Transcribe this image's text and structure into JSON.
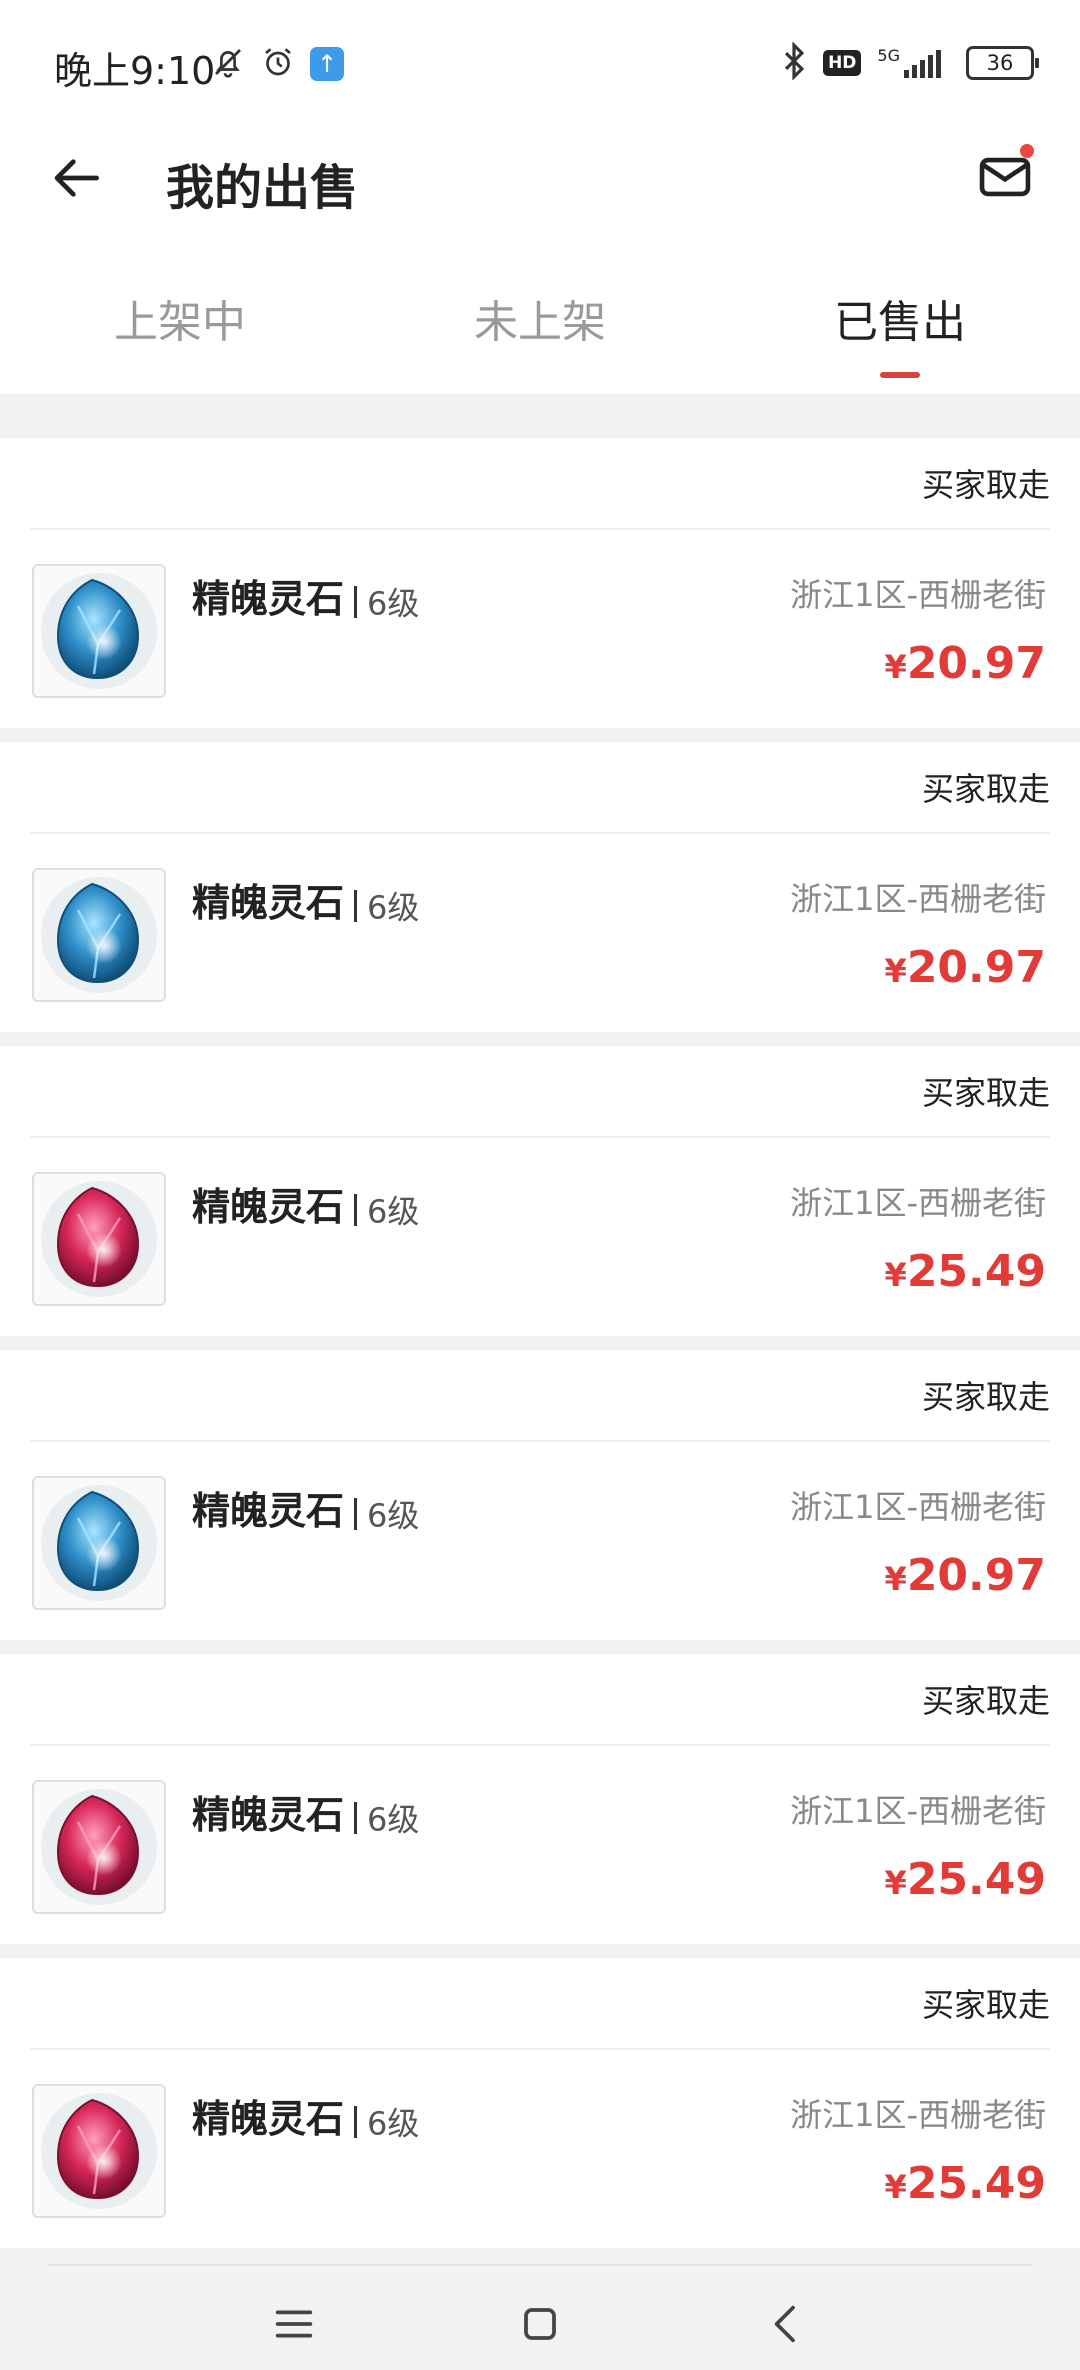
{
  "status_bar": {
    "time": "晚上9:10",
    "hd": "HD",
    "network": "5G",
    "battery": "36"
  },
  "header": {
    "title": "我的出售"
  },
  "tabs": [
    {
      "label": "上架中",
      "active": false
    },
    {
      "label": "未上架",
      "active": false
    },
    {
      "label": "已售出",
      "active": true
    }
  ],
  "orders": [
    {
      "status": "买家取走",
      "name": "精魄灵石",
      "level": "6级",
      "server": "浙江1区-西栅老街",
      "currency": "¥",
      "price": "20.97",
      "gem": "blue"
    },
    {
      "status": "买家取走",
      "name": "精魄灵石",
      "level": "6级",
      "server": "浙江1区-西栅老街",
      "currency": "¥",
      "price": "20.97",
      "gem": "blue"
    },
    {
      "status": "买家取走",
      "name": "精魄灵石",
      "level": "6级",
      "server": "浙江1区-西栅老街",
      "currency": "¥",
      "price": "25.49",
      "gem": "red"
    },
    {
      "status": "买家取走",
      "name": "精魄灵石",
      "level": "6级",
      "server": "浙江1区-西栅老街",
      "currency": "¥",
      "price": "20.97",
      "gem": "blue"
    },
    {
      "status": "买家取走",
      "name": "精魄灵石",
      "level": "6级",
      "server": "浙江1区-西栅老街",
      "currency": "¥",
      "price": "25.49",
      "gem": "red"
    },
    {
      "status": "买家取走",
      "name": "精魄灵石",
      "level": "6级",
      "server": "浙江1区-西栅老街",
      "currency": "¥",
      "price": "25.49",
      "gem": "red"
    }
  ],
  "colors": {
    "accent": "#d9443d",
    "price": "#e13a37",
    "gem_blue": "#2f8fc9",
    "gem_red": "#d8285a"
  },
  "icons": {
    "back": "arrow-left-icon",
    "mail": "mail-icon",
    "nav_menu": "menu-icon",
    "nav_home": "square-icon",
    "nav_back": "chevron-left-icon"
  }
}
